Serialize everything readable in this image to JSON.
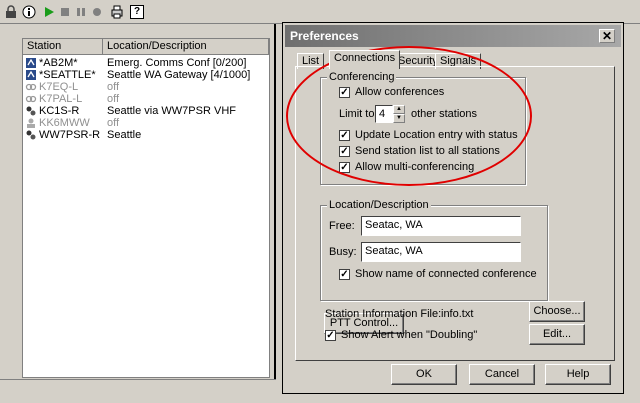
{
  "toolbar": {
    "icons": [
      "lock-icon",
      "info-icon",
      "play-icon",
      "stop-icon",
      "pause-icon",
      "record-icon",
      "print-icon",
      "help-icon"
    ],
    "help_label": "?"
  },
  "station_list": {
    "columns": [
      "Station",
      "Location/Description"
    ],
    "rows": [
      {
        "station": "*AB2M*",
        "location": "Emerg. Comms Conf [0/200]",
        "icon": "conference-icon",
        "dimmed": false
      },
      {
        "station": "*SEATTLE*",
        "location": "Seattle WA Gateway [4/1000]",
        "icon": "conference-icon",
        "dimmed": false
      },
      {
        "station": "K7EQ-L",
        "location": "off",
        "icon": "link-icon",
        "dimmed": true
      },
      {
        "station": "K7PAL-L",
        "location": "off",
        "icon": "link-icon",
        "dimmed": true
      },
      {
        "station": "KC1S-R",
        "location": "Seattle via WW7PSR VHF",
        "icon": "repeater-icon",
        "dimmed": false
      },
      {
        "station": "KK6MWW",
        "location": "off",
        "icon": "user-icon",
        "dimmed": true
      },
      {
        "station": "WW7PSR-R",
        "location": "Seattle",
        "icon": "repeater-icon",
        "dimmed": false
      }
    ]
  },
  "dialog": {
    "title": "Preferences",
    "close_label": "✕",
    "tabs": [
      "List",
      "Connections",
      "Security",
      "Signals"
    ],
    "active_tab": "Connections",
    "conferencing": {
      "label": "Conferencing",
      "allow_conferences": "Allow conferences",
      "limit_label": "Limit to",
      "limit_value": "4",
      "limit_suffix": "other stations",
      "update_location": "Update Location entry with status",
      "send_station_list": "Send station list to all stations",
      "allow_multi": "Allow multi-conferencing"
    },
    "location": {
      "label": "Location/Description",
      "free_label": "Free:",
      "free_value": "Seatac, WA",
      "busy_label": "Busy:",
      "busy_value": "Seatac, WA",
      "show_name": "Show name of connected conference"
    },
    "ptt_button": "PTT Control...",
    "station_info_label": "Station Information File:",
    "station_info_value": "info.txt",
    "choose_button": "Choose...",
    "show_alert": "Show Alert when \"Doubling\"",
    "edit_button": "Edit...",
    "ok_button": "OK",
    "cancel_button": "Cancel",
    "help_button": "Help"
  },
  "colors": {
    "annotation": "#e00000",
    "titlebar": "#6f6f6f",
    "face": "#d4d0c8"
  }
}
